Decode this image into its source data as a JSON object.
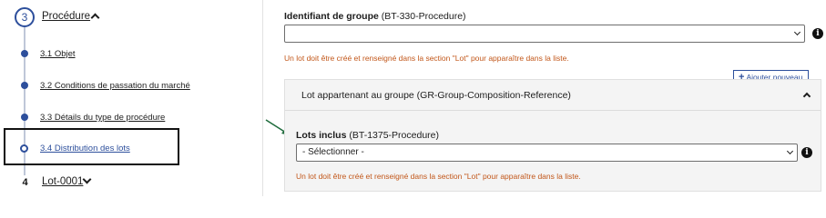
{
  "stepper": {
    "step3": {
      "number": "3",
      "title": "Procédure"
    },
    "substeps": [
      {
        "label": "3.1 Objet"
      },
      {
        "label": "3.2 Conditions de passation du marché"
      },
      {
        "label": "3.3 Détails du type de procédure"
      },
      {
        "label": "3.4 Distribution des lots"
      }
    ],
    "step4": {
      "number": "4",
      "title": "Lot-0001"
    }
  },
  "form": {
    "group_id": {
      "label_bold": "Identifiant de groupe",
      "label_code": "(BT-330-Procedure)",
      "value": ""
    },
    "hint_text": "Un lot doit être créé et renseigné dans la section \"Lot\" pour apparaître dans la liste.",
    "add_button_label": "Ajouter nouveau",
    "panel": {
      "title": "Lot appartenant au groupe (GR-Group-Composition-Reference)",
      "lots_inclus": {
        "label_bold": "Lots inclus",
        "label_code": "(BT-1375-Procedure)",
        "value": "- Sélectionner -"
      }
    },
    "info_glyph": "i"
  },
  "colors": {
    "accent": "#2d4f9c",
    "hint": "#c2571a",
    "arrow": "#1e6b3c"
  }
}
